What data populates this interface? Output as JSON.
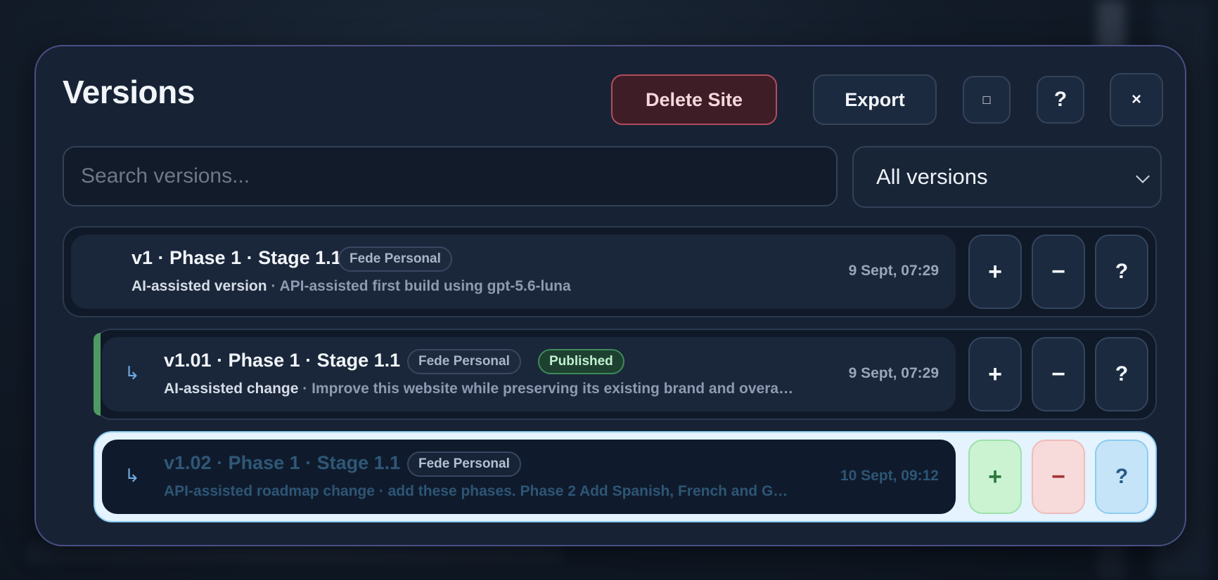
{
  "modal": {
    "title": "Versions",
    "delete_label": "Delete Site",
    "export_label": "Export",
    "expand_glyph": "□",
    "help_glyph": "?",
    "close_glyph": "×"
  },
  "search": {
    "placeholder": "Search versions..."
  },
  "filter": {
    "selected": "All versions"
  },
  "versions": [
    {
      "title": "v1 · Phase 1 · Stage 1.1",
      "tags": [
        "Fede Personal"
      ],
      "lead": "AI-assisted version",
      "description": " · API-assisted first build using gpt-5.6-luna",
      "date": "9 Sept, 07:29",
      "actions": [
        "+",
        "−",
        "?"
      ]
    },
    {
      "title": "v1.01 · Phase 1 · Stage 1.1",
      "arrow": "↳",
      "tags": [
        "Fede Personal",
        "Published"
      ],
      "lead": "AI-assisted change",
      "description": " · Improve this website while preserving its existing brand and overa…",
      "date": "9 Sept, 07:29",
      "actions": [
        "+",
        "−",
        "?"
      ]
    },
    {
      "title": "v1.02 · Phase 1 · Stage 1.1",
      "arrow": "↳",
      "tags": [
        "Fede Personal"
      ],
      "lead": "API-assisted roadmap change",
      "description": " · add these phases. Phase 2 Add Spanish, French and G…",
      "date": "10 Sept, 09:12",
      "actions": [
        "+",
        "−",
        "?"
      ]
    }
  ],
  "colors": {
    "accent_published": "#4e9a62",
    "selected_row_border": "#8ecbf1",
    "delete_border": "#b14d5e"
  }
}
